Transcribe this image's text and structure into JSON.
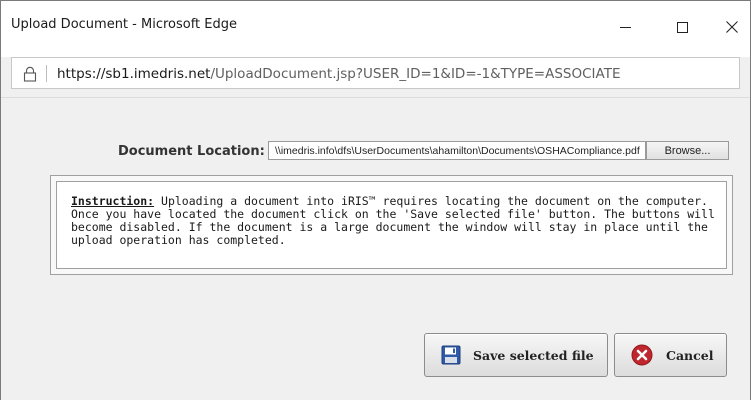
{
  "window": {
    "title": "Upload Document - Microsoft Edge"
  },
  "address_bar": {
    "url_host": "https://sb1.imedris.net",
    "url_path": "/UploadDocument.jsp?USER_ID=1&ID=-1&TYPE=ASSOCIATE"
  },
  "form": {
    "location_label": "Document Location:",
    "file_path_value": "\\\\imedris.info\\dfs\\UserDocuments\\ahamilton\\Documents\\OSHACompliance.pdf",
    "browse_label": "Browse..."
  },
  "instruction": {
    "heading": "Instruction:",
    "line1": " Uploading a document into iRIS™ requires locating the document on the computer.",
    "line2": "Once you have located the document click on the 'Save selected file' button. The buttons will",
    "line3": "become disabled. If the document is a large document the window will stay in place until the",
    "line4": "upload operation has completed."
  },
  "buttons": {
    "save_label": "Save selected file",
    "cancel_label": "Cancel"
  },
  "colors": {
    "cancel_icon": "#c0262d",
    "save_icon": "#2f5aa8"
  },
  "icons": {
    "lock": "lock-icon",
    "save": "floppy-disk-icon",
    "cancel": "cancel-x-icon"
  }
}
